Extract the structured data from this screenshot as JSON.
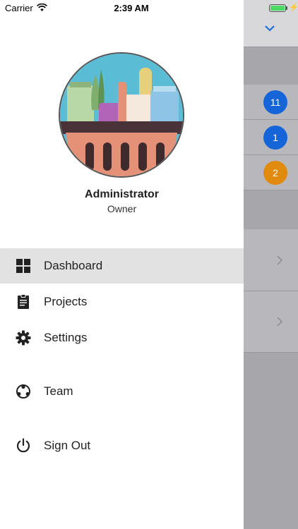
{
  "status_bar": {
    "carrier": "Carrier",
    "time": "2:39 AM"
  },
  "user": {
    "name": "Administrator",
    "role": "Owner"
  },
  "menu": [
    {
      "label": "Dashboard",
      "icon": "dashboard-icon",
      "active": true
    },
    {
      "label": "Projects",
      "icon": "clipboard-icon",
      "active": false
    },
    {
      "label": "Settings",
      "icon": "gear-icon",
      "active": false
    },
    {
      "label": "Team",
      "icon": "team-icon",
      "active": false
    },
    {
      "label": "Sign Out",
      "icon": "power-icon",
      "active": false
    }
  ],
  "background_badges": [
    {
      "count": "11",
      "color": "#1565d8"
    },
    {
      "count": "1",
      "color": "#1565d8"
    },
    {
      "count": "2",
      "color": "#e08a0e"
    }
  ],
  "colors": {
    "active_row": "#e2e2e2",
    "overlay": "#a7a7ab"
  }
}
